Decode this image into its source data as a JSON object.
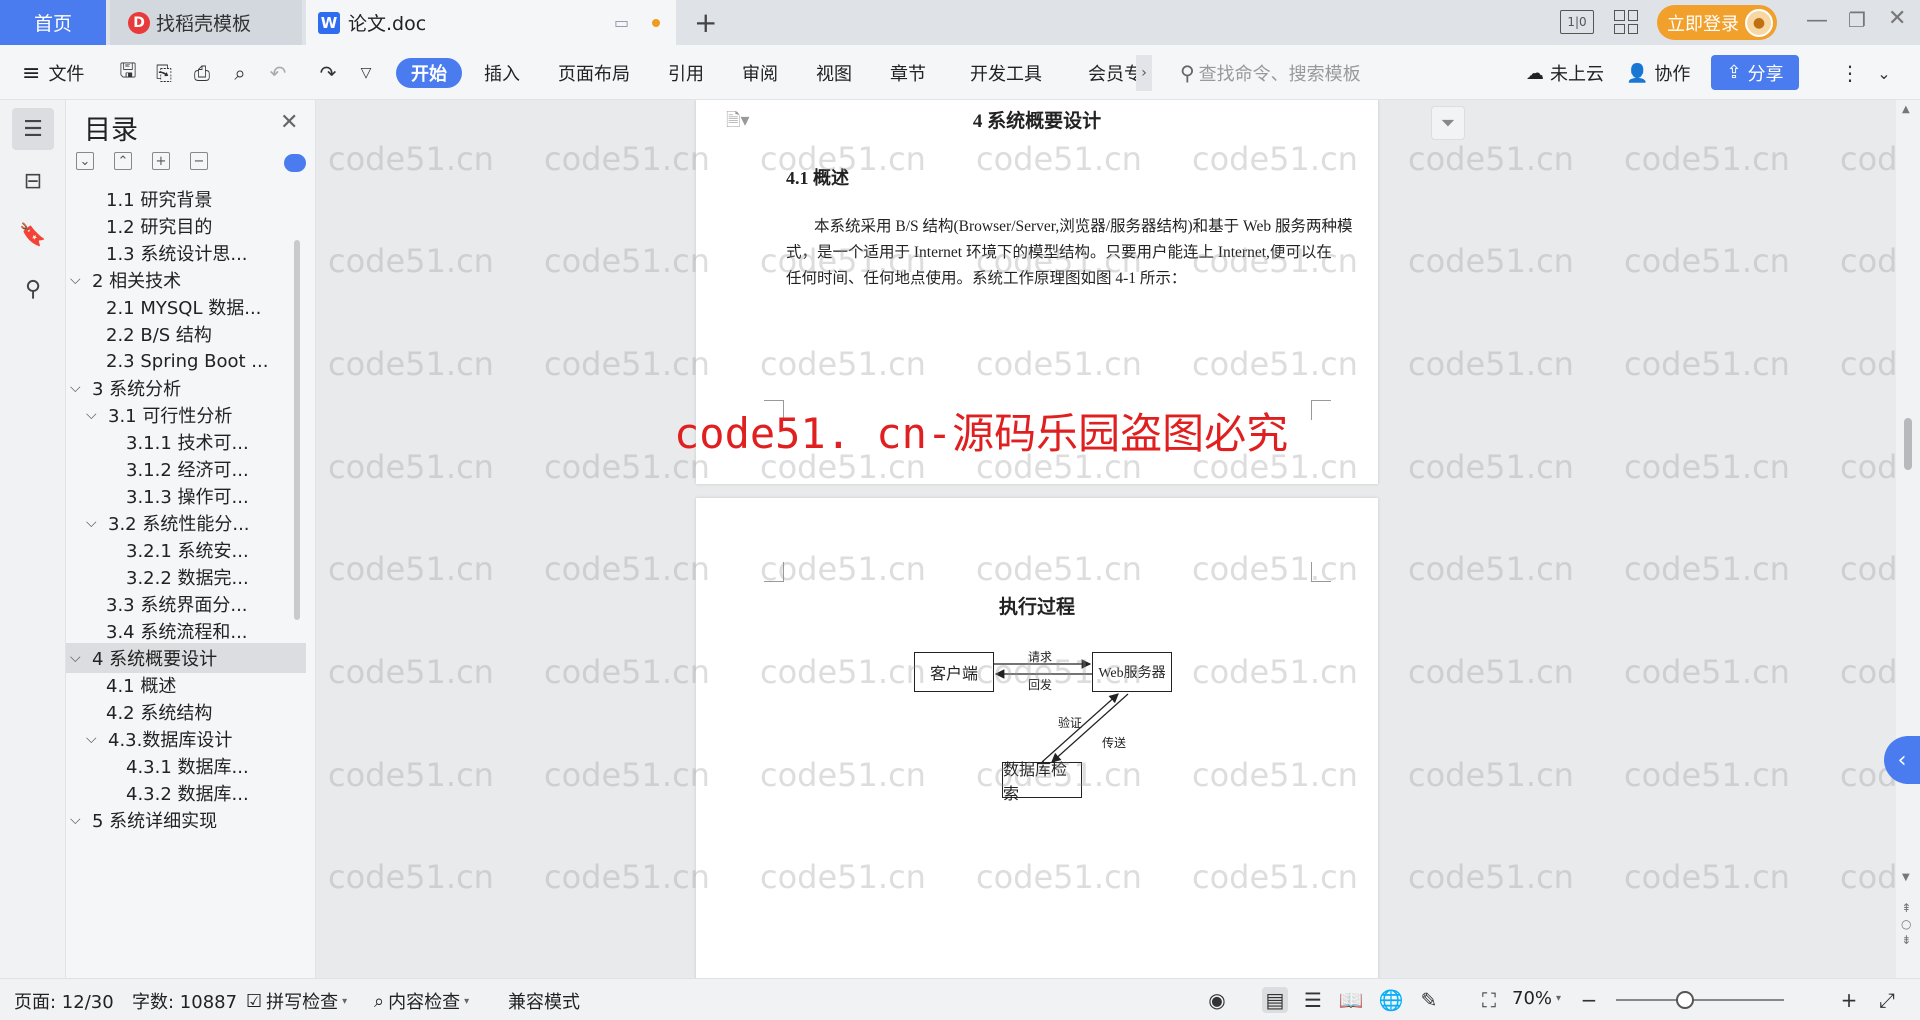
{
  "tabs": {
    "home": "首页",
    "templates": "找稻壳模板",
    "doc": "论文.doc"
  },
  "titlebar": {
    "login": "立即登录"
  },
  "toolbar": {
    "file": "文件",
    "start": "开始",
    "insert": "插入",
    "layout": "页面布局",
    "reference": "引用",
    "review": "审阅",
    "view": "视图",
    "chapter": "章节",
    "devtools": "开发工具",
    "member": "会员专",
    "search_placeholder": "查找命令、搜索模板",
    "cloud": "未上云",
    "collab": "协作",
    "share": "分享"
  },
  "toc": {
    "title": "目录",
    "items": [
      {
        "label": "1.1  研究背景",
        "level": 2
      },
      {
        "label": "1.2 研究目的",
        "level": 2
      },
      {
        "label": "1.3 系统设计思...",
        "level": 2
      },
      {
        "label": "2 相关技术",
        "level": 1
      },
      {
        "label": "2.1 MYSQL 数据...",
        "level": 2
      },
      {
        "label": "2.2 B/S 结构",
        "level": 2
      },
      {
        "label": "2.3 Spring Boot ...",
        "level": 2
      },
      {
        "label": "3 系统分析",
        "level": 1
      },
      {
        "label": "3.1 可行性分析",
        "level": 2
      },
      {
        "label": "3.1.1 技术可...",
        "level": 3
      },
      {
        "label": "3.1.2 经济可...",
        "level": 3
      },
      {
        "label": "3.1.3 操作可...",
        "level": 3
      },
      {
        "label": "3.2 系统性能分...",
        "level": 2
      },
      {
        "label": "3.2.1  系统安...",
        "level": 3
      },
      {
        "label": "3.2.2  数据完...",
        "level": 3
      },
      {
        "label": "3.3 系统界面分...",
        "level": 2
      },
      {
        "label": "3.4 系统流程和...",
        "level": 2
      },
      {
        "label": "4 系统概要设计",
        "level": 1
      },
      {
        "label": "4.1 概述",
        "level": 2
      },
      {
        "label": "4.2 系统结构",
        "level": 2
      },
      {
        "label": "4.3.数据库设计",
        "level": 2
      },
      {
        "label": "4.3.1 数据库...",
        "level": 3
      },
      {
        "label": "4.3.2 数据库...",
        "level": 3
      },
      {
        "label": "5 系统详细实现",
        "level": 1
      }
    ]
  },
  "document": {
    "chapter_title": "4 系统概要设计",
    "section_title": "4.1 概述",
    "para_line1": "本系统采用 B/S 结构(Browser/Server,浏览器/服务器结构)和基于 Web 服务两种模",
    "para_line2": "式，是一个适用于 Internet 环境下的模型结构。只要用户能连上 Internet,便可以在",
    "para_line3": "任何时间、任何地点使用。系统工作原理图如图 4-1 所示：",
    "figure_title": "执行过程",
    "diagram": {
      "client": "客户端",
      "web": "Web服务器",
      "db": "数据库检索",
      "request": "请求",
      "reply": "回发",
      "verify": "验证",
      "transfer": "传送"
    }
  },
  "watermark": {
    "text": "code51.cn",
    "banner": "code51. cn-源码乐园盗图必究"
  },
  "status": {
    "page": "页面: 12/30",
    "words": "字数: 10887",
    "spell": "拼写检查",
    "content": "内容检查",
    "compat": "兼容模式",
    "zoom": "70%"
  }
}
